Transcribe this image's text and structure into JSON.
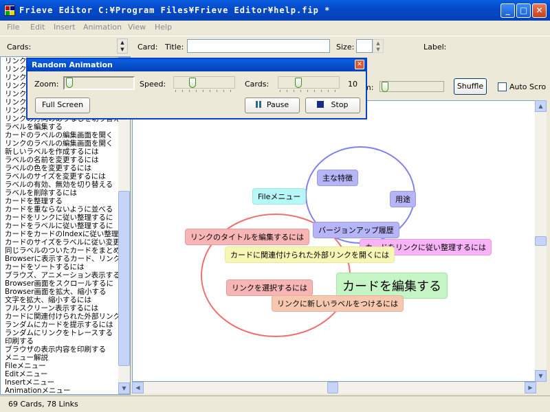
{
  "window": {
    "title": "Frieve Editor C:¥Program Files¥Frieve Editor¥help.fip *"
  },
  "menu": [
    "File",
    "Edit",
    "Insert",
    "Animation",
    "View",
    "Help"
  ],
  "toolbar": {
    "cards_label": "Cards:",
    "card_label": "Card:",
    "title_label": "Title:",
    "title_value": "",
    "size_label": "Size:",
    "size_value": "",
    "label_label": "Label:"
  },
  "subbar": {
    "zoom_fragment": "m:",
    "shuffle": "Shuffle",
    "auto_scroll": "Auto Scro"
  },
  "card_list": [
    "リンク",
    "リンク",
    "リンク",
    "リンク",
    "リンク",
    "リンク",
    "リンク",
    "リンクの方向のありなしを切り替え",
    "ラベルを編集する",
    "カードのラベルの編集画面を開く",
    "リンクのラベルの編集画面を開く",
    "新しいラベルを作成するには",
    "ラベルの名前を変更するには",
    "ラベルの色を変更するには",
    "ラベルのサイズを変更するには",
    "ラベルの有効、無効を切り替える",
    "ラベルを削除するには",
    "カードを整理する",
    "カードを重ならないように並べる",
    "カードをリンクに従い整理するに",
    "カードをラベルに従い整理するに",
    "カードをカードのIndexに従い整理",
    "カードのサイズをラベルに従い変更",
    "同じラベルのついたカードをまとめる",
    "Browserに表示するカード、リンク",
    "カードをソートするには",
    "ブラウズ、アニメーション表示する",
    "Browser画面をスクロールするに",
    "Browser画面を拡大、縮小する",
    "文字を拡大、縮小するには",
    "フルスクリーン表示するには",
    "カードに関連付けられた外部リンク",
    "ランダムにカードを提示するには",
    "ランダムにリンクをトレースする",
    "印刷する",
    "ブラウザの表示内容を印刷する",
    "メニュー解説",
    "Fileメニュー",
    "Editメニュー",
    "Insertメニュー",
    "Animationメニュー"
  ],
  "status": {
    "text": "69 Cards, 78 Links"
  },
  "dialog": {
    "title": "Random Animation",
    "zoom_label": "Zoom:",
    "speed_label": "Speed:",
    "cards_label": "Cards:",
    "cards_value": "10",
    "full_screen": "Full Screen",
    "pause": "Pause",
    "stop": "Stop"
  },
  "cards": [
    {
      "text": "主な特徴",
      "bg": "#b5b5f7"
    },
    {
      "text": "Fileメニュー",
      "bg": "#b8f7f7"
    },
    {
      "text": "用途",
      "bg": "#b5b5f7"
    },
    {
      "text": "バージョンアップ履歴",
      "bg": "#b5b5f7"
    },
    {
      "text": "カードをリンクに従い整理するには",
      "bg": "#f7b5f7"
    },
    {
      "text": "リンクのタイトルを編集するには",
      "bg": "#f7b5b5"
    },
    {
      "text": "カードに関連付けられた外部リンクを開くには",
      "bg": "#f7f7b5"
    },
    {
      "text": "カードを編集する",
      "bg": "#c5f5c5"
    },
    {
      "text": "リンクを選択するには",
      "bg": "#f7b5b5"
    },
    {
      "text": "リンクに新しいラベルをつけるには",
      "bg": "#f7c8b0"
    }
  ],
  "colors": {
    "ellipse_blue": "#8080f0",
    "ellipse_red": "#f07070",
    "titlebar": "#0449c9"
  }
}
